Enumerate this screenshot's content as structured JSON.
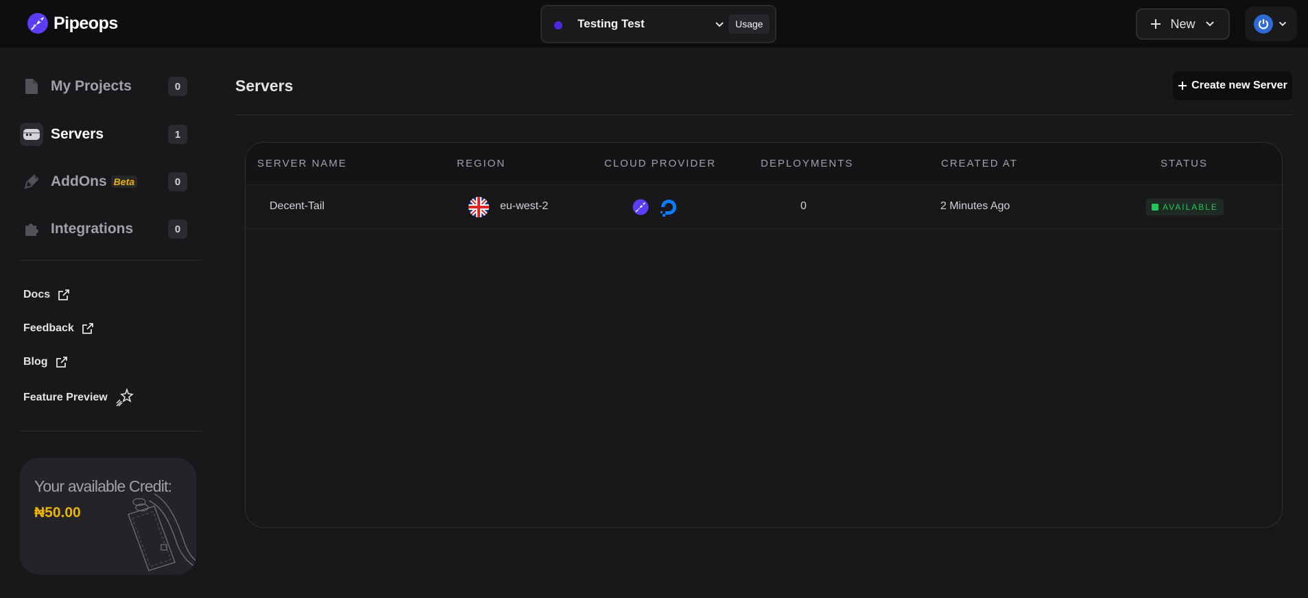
{
  "brand": {
    "name": "Pipeops"
  },
  "project": {
    "name": "Testing Test",
    "usage_label": "Usage",
    "accent": "#4f29e0"
  },
  "header": {
    "new_label": "New"
  },
  "sidebar": {
    "items": [
      {
        "label": "My Projects",
        "count": "0",
        "icon": "file-icon",
        "active": false
      },
      {
        "label": "Servers",
        "count": "1",
        "icon": "server-icon",
        "active": true
      },
      {
        "label": "AddOns",
        "count": "0",
        "icon": "plug-icon",
        "active": false,
        "tag": "Beta"
      },
      {
        "label": "Integrations",
        "count": "0",
        "icon": "puzzle-icon",
        "active": false
      }
    ],
    "links": [
      {
        "label": "Docs",
        "icon": "external-link-icon"
      },
      {
        "label": "Feedback",
        "icon": "external-link-icon"
      },
      {
        "label": "Blog",
        "icon": "external-link-icon"
      },
      {
        "label": "Feature Preview",
        "icon": "sparkle-star-icon"
      }
    ],
    "credit": {
      "title": "Your available Credit:",
      "value": "₦50.00",
      "value_color": "#eab308"
    }
  },
  "main": {
    "title": "Servers",
    "create_label": "Create new Server",
    "table": {
      "columns": [
        "Server Name",
        "Region",
        "Cloud Provider",
        "Deployments",
        "Created At",
        "Status"
      ],
      "rows": [
        {
          "name": "Decent-Tail",
          "region": "eu-west-2",
          "region_flag": "uk-flag-icon",
          "providers": [
            "pipeops-icon",
            "digitalocean-icon"
          ],
          "deployments": "0",
          "created_at": "2 Minutes Ago",
          "status": "AVAILABLE",
          "status_color": "#22c55e"
        }
      ]
    }
  }
}
